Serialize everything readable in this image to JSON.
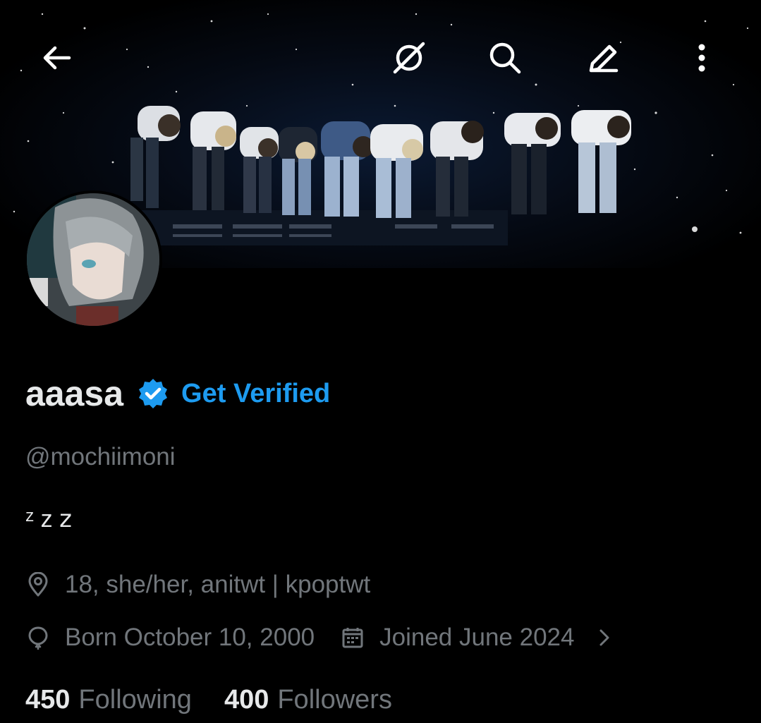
{
  "topbar": {
    "back_icon": "arrow-left-icon",
    "grok_icon": "grok-icon",
    "search_icon": "search-icon",
    "edit_icon": "pencil-icon",
    "more_icon": "more-vertical-icon"
  },
  "banner": {
    "description_icon": "concert-banner-image"
  },
  "profile": {
    "display_name": "aaasa",
    "verified_badge_icon": "verified-badge-icon",
    "get_verified_label": "Get Verified",
    "handle": "@mochiimoni",
    "bio": "ᶻ z 𝗓",
    "location": "18, she/her, anitwt | kpoptwt",
    "birthday": "Born October 10, 2000",
    "joined": "Joined June 2024",
    "following_count": "450",
    "following_label": "Following",
    "followers_count": "400",
    "followers_label": "Followers"
  },
  "colors": {
    "background": "#000000",
    "text_primary": "#e7e9ea",
    "text_secondary": "#71767b",
    "accent": "#1d9bf0"
  }
}
